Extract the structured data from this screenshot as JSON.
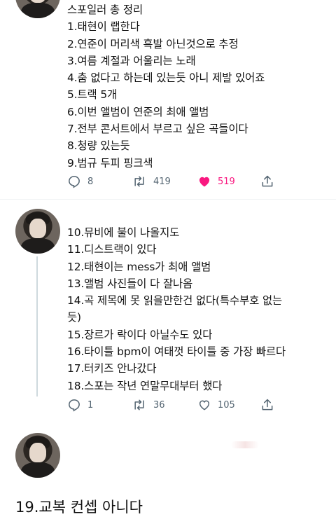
{
  "tweet1": {
    "lines": [
      "스포일러 총 정리",
      "1.태현이 랩한다",
      "2.연준이 머리색 흑발 아닌것으로 추정",
      "3.여름 계절과 어울리는 노래",
      "4.춤 없다고 하는데 있는듯 아니 제발 있어죠",
      "5.트랙 5개",
      "6.이번 앨범이 연준의 최애 앨범",
      "7.전부 콘서트에서 부르고 싶은 곡들이다",
      "8.청량 있는듯",
      "9.범규 두피 핑크색"
    ],
    "replies": "8",
    "retweets": "419",
    "likes": "519",
    "like_color": "#f91880"
  },
  "tweet2": {
    "lines": [
      "10.뮤비에 불이 나올지도",
      "11.디스트랙이 있다",
      "12.태현이는 mess가 최애 앨범",
      "13.앨범 사진들이 다 잘나옴",
      "14.곡 제목에 못 읽을만한건 없다(특수부호 없는",
      "듯)",
      "15.장르가 락이다 아닐수도 있다",
      "16.타이틀 bpm이 여태껏 타이틀 중 가장 빠르다",
      "17.터키즈 안나갔다",
      "18.스포는 작년 연말무대부터 했다"
    ],
    "replies": "1",
    "retweets": "36",
    "likes": "105"
  },
  "tweet3": {
    "text": "19.교복 컨셉 아니다"
  },
  "colors": {
    "action_gray": "#536471",
    "thread_line": "#cfd9de"
  },
  "icons": [
    "reply-icon",
    "retweet-icon",
    "like-icon",
    "share-icon"
  ]
}
